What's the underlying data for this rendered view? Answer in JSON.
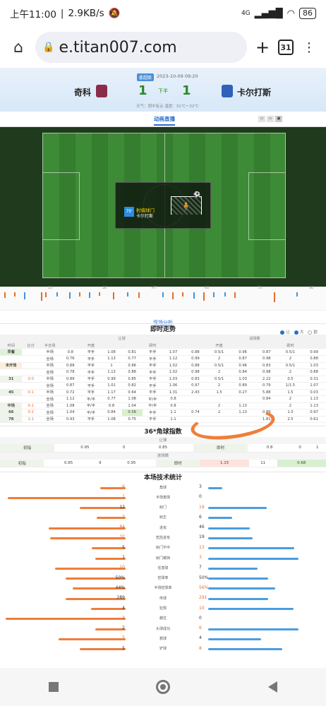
{
  "status": {
    "time": "上午11:00",
    "speed": "2.9KB/s",
    "network": "4G",
    "battery": "86"
  },
  "browser": {
    "url": "e.titan007.com",
    "tab_count": "31"
  },
  "match": {
    "league_tag": "委超联",
    "datetime": "2023-10-09 09:20",
    "home_team": "奇科",
    "away_team": "卡尔打斯",
    "home_score": "1",
    "away_score": "1",
    "period": "下半",
    "weather": "天气：阴中有云    温度：31℃～32℃",
    "home_color": "#8b2c4a",
    "away_color": "#2f62b8"
  },
  "live": {
    "tab": "动画直播",
    "event_minute": "79'",
    "event_title": "射偏球门",
    "event_team": "卡尔打斯"
  },
  "timeline": {
    "labels": [
      "15",
      "30",
      "HT",
      "60",
      "75",
      "90"
    ]
  },
  "analysis": {
    "tab": "现场分析",
    "title": "即时走势",
    "filters": [
      "让",
      "大",
      "欧"
    ],
    "headers": [
      "时间",
      "比分",
      "半全场",
      "开盘",
      "即时",
      "开盘",
      "即时"
    ],
    "group_headers": [
      "让球",
      "进球数"
    ],
    "rows": [
      [
        "早餐",
        "",
        "半场",
        "0.8",
        "平手",
        "1.08",
        "0.81",
        "平手",
        "1.07",
        "0.88",
        "0.5/1",
        "0.96",
        "0.87",
        "0.5/1",
        "0.99"
      ],
      [
        "",
        "",
        "全场",
        "0.76",
        "平手",
        "1.13",
        "0.77",
        "平手",
        "1.12",
        "0.99",
        "2",
        "0.87",
        "0.98",
        "2",
        "0.88"
      ],
      [
        "未开场",
        "",
        "半场",
        "0.88",
        "平手",
        "1",
        "0.86",
        "平手",
        "1.02",
        "0.88",
        "0.5/1",
        "0.96",
        "0.83",
        "0.5/1",
        "1.03"
      ],
      [
        "",
        "",
        "全场",
        "0.78",
        "平手",
        "1.13",
        "0.88",
        "平手",
        "1.02",
        "0.98",
        "2",
        "0.84",
        "0.98",
        "2",
        "0.88"
      ],
      [
        "31",
        "0:0",
        "半场",
        "0.89",
        "平手",
        "0.99",
        "0.85",
        "平手",
        "1.03",
        "0.83",
        "0.5/1",
        "1.03",
        "2.22",
        "0.5",
        "0.31"
      ],
      [
        "",
        "",
        "全场",
        "0.87",
        "平手",
        "1.01",
        "0.82",
        "平手",
        "1.06",
        "0.97",
        "2",
        "0.89",
        "0.79",
        "1/1.5",
        "1.07"
      ],
      [
        "45",
        "0:1",
        "半场",
        "0.72",
        "平手",
        "1.17",
        "0.64",
        "平手",
        "1.31",
        "2.43",
        "1.5",
        "0.27",
        "5.88",
        "1.5",
        "0.03"
      ],
      [
        "",
        "",
        "全场",
        "1.12",
        "平/半",
        "0.77",
        "1.08",
        "平/半",
        "0.8",
        "",
        "",
        "",
        "0.84",
        "2",
        "1.13"
      ],
      [
        "中场",
        "0:1",
        "全场",
        "1.08",
        "平/半",
        "0.8",
        "1.04",
        "平/半",
        "0.8",
        "",
        "2",
        "1.13",
        "",
        "2",
        "1.13"
      ],
      [
        "66",
        "0:1",
        "全场",
        "1.04",
        "平/半",
        "0.84",
        "0.58",
        "平手",
        "1.1",
        "0.74",
        "2",
        "1.13",
        "0.89",
        "1.5",
        "0.97"
      ],
      [
        "78",
        "1:1",
        "全场",
        "0.93",
        "平手",
        "1.08",
        "0.75",
        "平手",
        "1.1",
        "",
        "",
        "",
        "1.81",
        "2.5",
        "0.61"
      ]
    ]
  },
  "corners": {
    "title": "36*角球指数",
    "handicap_label": "让球",
    "total_label": "进球数",
    "row1": [
      "初指",
      "0.95",
      "0",
      "0.85",
      "即时",
      "0.8",
      "0",
      "1"
    ],
    "row2": [
      "初指",
      "0.85",
      "9",
      "0.95",
      "即时",
      "1.15",
      "11",
      "0.68"
    ]
  },
  "stats": {
    "title": "本场技术统计",
    "rows": [
      {
        "name": "角球",
        "home": "6",
        "away": "3",
        "hf": 0.21,
        "af": 0.12
      },
      {
        "name": "半场角球",
        "home": "1",
        "away": "0",
        "hf": 0.98,
        "af": 0.0
      },
      {
        "name": "射门",
        "home": "12",
        "away": "19",
        "hf": 0.38,
        "af": 0.49
      },
      {
        "name": "射正",
        "home": "7",
        "away": "6",
        "hf": 0.24,
        "af": 0.2
      },
      {
        "name": "进攻",
        "home": "84",
        "away": "46",
        "hf": 0.64,
        "af": 0.35
      },
      {
        "name": "危险进攻",
        "home": "32",
        "away": "19",
        "hf": 0.63,
        "af": 0.37
      },
      {
        "name": "射门不中",
        "home": "5",
        "away": "13",
        "hf": 0.28,
        "af": 0.72
      },
      {
        "name": "射门被挡",
        "home": "1",
        "away": "3",
        "hf": 0.25,
        "af": 0.75
      },
      {
        "name": "任意球",
        "home": "10",
        "away": "7",
        "hf": 0.59,
        "af": 0.41
      },
      {
        "name": "控球率",
        "home": "50%",
        "away": "50%",
        "hf": 0.5,
        "af": 0.5
      },
      {
        "name": "半场控球率",
        "home": "44%",
        "away": "56%",
        "hf": 0.44,
        "af": 0.56
      },
      {
        "name": "传球",
        "home": "289",
        "away": "291",
        "hf": 0.5,
        "af": 0.5
      },
      {
        "name": "犯规",
        "home": "4",
        "away": "10",
        "hf": 0.29,
        "af": 0.71
      },
      {
        "name": "越位",
        "home": "3",
        "away": "0",
        "hf": 1.0,
        "af": 0.0
      },
      {
        "name": "头球成功",
        "home": "2",
        "away": "6",
        "hf": 0.25,
        "af": 0.75
      },
      {
        "name": "救球",
        "home": "5",
        "away": "4",
        "hf": 0.56,
        "af": 0.44
      },
      {
        "name": "铲球",
        "home": "5",
        "away": "8",
        "hf": 0.38,
        "af": 0.62
      }
    ]
  }
}
